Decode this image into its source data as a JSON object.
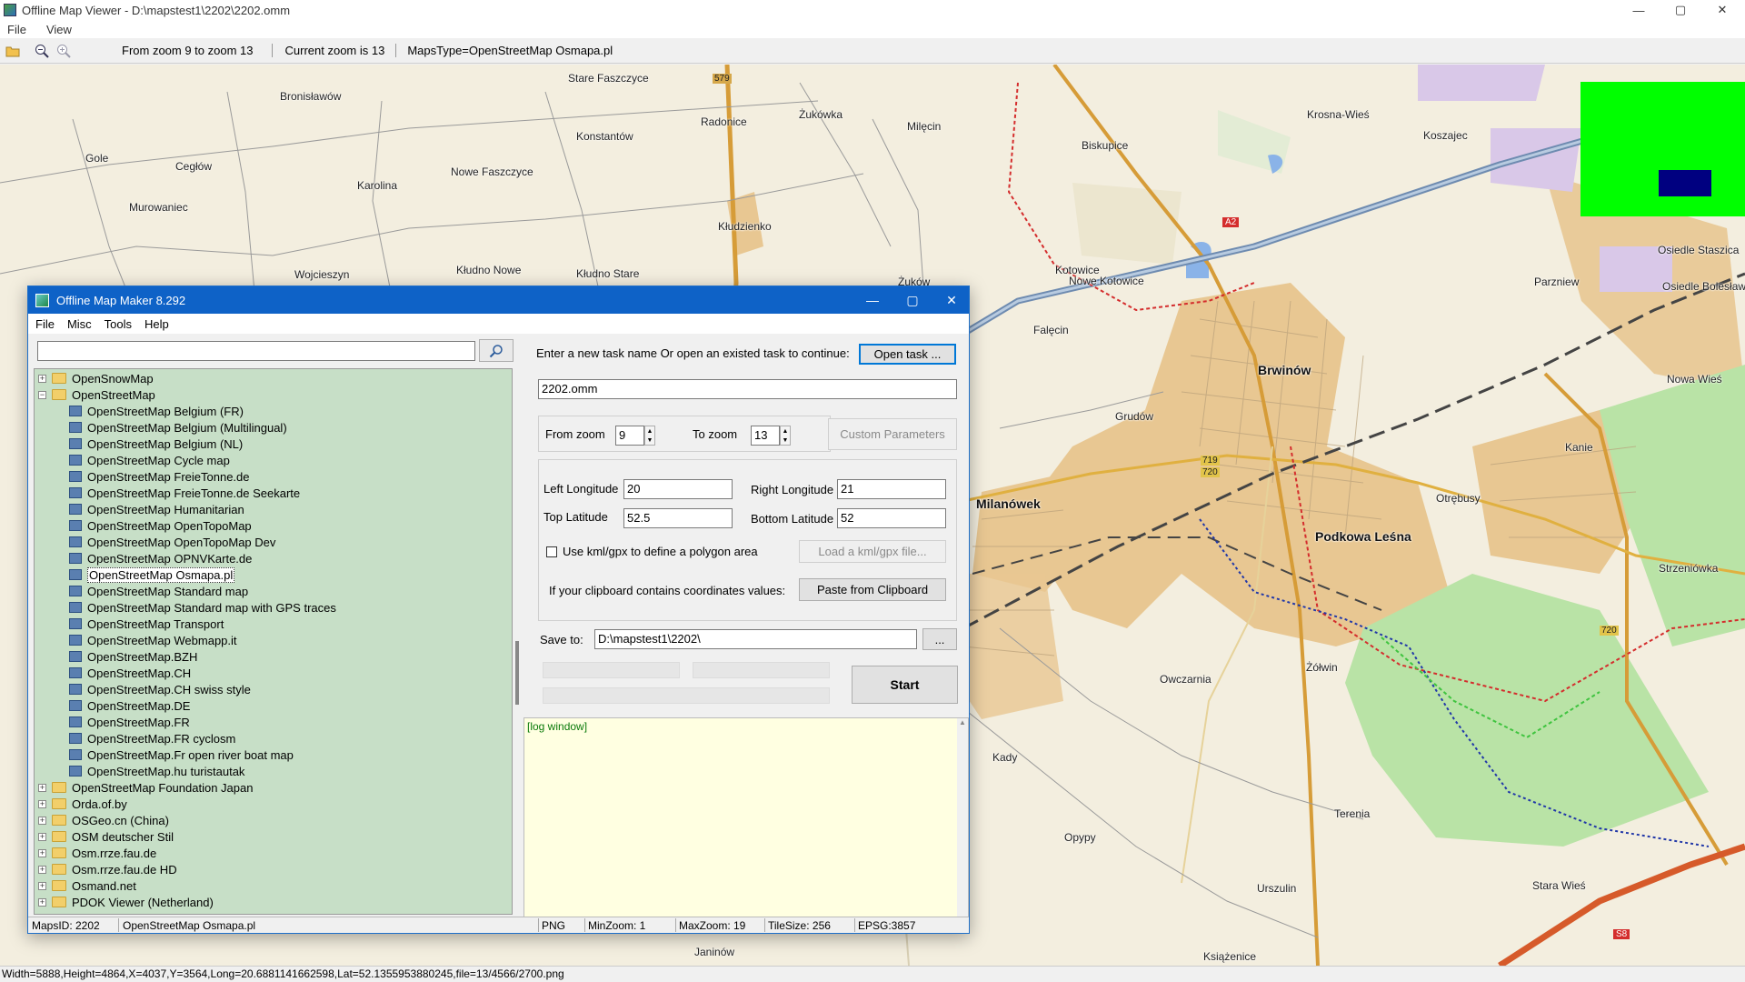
{
  "window": {
    "title": "Offline Map Viewer - D:\\mapstest1\\2202\\2202.omm",
    "menu": [
      "File",
      "View"
    ],
    "controls": {
      "minimize": "—",
      "maximize": "▢",
      "close": "✕"
    }
  },
  "toolbar": {
    "zoom_range": "From zoom 9 to zoom 13",
    "current_zoom": "Current zoom is 13",
    "maps_type": "MapsType=OpenStreetMap Osmapa.pl",
    "icons": [
      "open-folder-icon",
      "zoom-out-icon",
      "zoom-in-icon"
    ]
  },
  "map": {
    "places": [
      {
        "name": "Stare Faszczyce",
        "big": false
      },
      {
        "name": "Bronisławów",
        "big": false
      },
      {
        "name": "Radonice",
        "big": false
      },
      {
        "name": "Żukówka",
        "big": false
      },
      {
        "name": "Milęcin",
        "big": false
      },
      {
        "name": "Konstantów",
        "big": false
      },
      {
        "name": "Gole",
        "big": false
      },
      {
        "name": "Cegłów",
        "big": false
      },
      {
        "name": "Karolina",
        "big": false
      },
      {
        "name": "Nowe Faszczyce",
        "big": false
      },
      {
        "name": "Murowaniec",
        "big": false
      },
      {
        "name": "Kłudzienko",
        "big": false
      },
      {
        "name": "Wojcieszyn",
        "big": false
      },
      {
        "name": "Kłudno Nowe",
        "big": false
      },
      {
        "name": "Kłudno Stare",
        "big": false
      },
      {
        "name": "Żuków",
        "big": false
      },
      {
        "name": "Krosna-Wieś",
        "big": false
      },
      {
        "name": "Koszajec",
        "big": false
      },
      {
        "name": "Biskupice",
        "big": false
      },
      {
        "name": "Kotowice",
        "big": false
      },
      {
        "name": "Nowe Kotowice",
        "big": false
      },
      {
        "name": "Osiedle Staszica",
        "big": false
      },
      {
        "name": "Osiedle Bolesława",
        "big": false
      },
      {
        "name": "Parzniew",
        "big": false
      },
      {
        "name": "Falęcin",
        "big": false
      },
      {
        "name": "Brwinów",
        "big": true
      },
      {
        "name": "Nowa Wieś",
        "big": false
      },
      {
        "name": "Grudów",
        "big": false
      },
      {
        "name": "Milanówek",
        "big": true
      },
      {
        "name": "Otrębusy",
        "big": false
      },
      {
        "name": "Kanie",
        "big": false
      },
      {
        "name": "Podkowa Leśna",
        "big": true
      },
      {
        "name": "Strzeniówka",
        "big": false
      },
      {
        "name": "Owczarnia",
        "big": false
      },
      {
        "name": "Żółwin",
        "big": false
      },
      {
        "name": "Kady",
        "big": false
      },
      {
        "name": "Opypy",
        "big": false
      },
      {
        "name": "Terenia",
        "big": false
      },
      {
        "name": "Urszulin",
        "big": false
      },
      {
        "name": "Stara Wieś",
        "big": false
      },
      {
        "name": "Janinów",
        "big": false
      },
      {
        "name": "Książenice",
        "big": false
      }
    ],
    "road_numbers": [
      "579",
      "719",
      "720",
      "720",
      "A2",
      "S8"
    ]
  },
  "status": "Width=5888,Height=4864,X=4037,Y=3564,Long=20.6881141662598,Lat=52.1355953880245,file=13/4566/2700.png",
  "dialog": {
    "title": "Offline Map Maker 8.292",
    "menu": [
      "File",
      "Misc",
      "Tools",
      "Help"
    ],
    "search": {
      "value": "",
      "icon": "search-icon"
    },
    "tree": [
      {
        "label": "OpenSnowMap",
        "type": "folder",
        "expanded": false,
        "level": 0
      },
      {
        "label": "OpenStreetMap",
        "type": "folder",
        "expanded": true,
        "level": 0
      },
      {
        "label": "OpenStreetMap Belgium (FR)",
        "type": "map",
        "level": 1
      },
      {
        "label": "OpenStreetMap Belgium (Multilingual)",
        "type": "map",
        "level": 1
      },
      {
        "label": "OpenStreetMap Belgium (NL)",
        "type": "map",
        "level": 1
      },
      {
        "label": "OpenStreetMap Cycle map",
        "type": "map",
        "level": 1
      },
      {
        "label": "OpenStreetMap FreieTonne.de",
        "type": "map",
        "level": 1
      },
      {
        "label": "OpenStreetMap FreieTonne.de Seekarte",
        "type": "map",
        "level": 1
      },
      {
        "label": "OpenStreetMap Humanitarian",
        "type": "map",
        "level": 1
      },
      {
        "label": "OpenStreetMap OpenTopoMap",
        "type": "map",
        "level": 1
      },
      {
        "label": "OpenStreetMap OpenTopoMap Dev",
        "type": "map",
        "level": 1
      },
      {
        "label": "OpenStreetMap OPNVKarte.de",
        "type": "map",
        "level": 1
      },
      {
        "label": "OpenStreetMap Osmapa.pl",
        "type": "map",
        "level": 1,
        "selected": true
      },
      {
        "label": "OpenStreetMap Standard map",
        "type": "map",
        "level": 1
      },
      {
        "label": "OpenStreetMap Standard map with GPS traces",
        "type": "map",
        "level": 1
      },
      {
        "label": "OpenStreetMap Transport",
        "type": "map",
        "level": 1
      },
      {
        "label": "OpenStreetMap Webmapp.it",
        "type": "map",
        "level": 1
      },
      {
        "label": "OpenStreetMap.BZH",
        "type": "map",
        "level": 1
      },
      {
        "label": "OpenStreetMap.CH",
        "type": "map",
        "level": 1
      },
      {
        "label": "OpenStreetMap.CH swiss style",
        "type": "map",
        "level": 1
      },
      {
        "label": "OpenStreetMap.DE",
        "type": "map",
        "level": 1
      },
      {
        "label": "OpenStreetMap.FR",
        "type": "map",
        "level": 1
      },
      {
        "label": "OpenStreetMap.FR cyclosm",
        "type": "map",
        "level": 1
      },
      {
        "label": "OpenStreetMap.Fr open river boat map",
        "type": "map",
        "level": 1
      },
      {
        "label": "OpenStreetMap.hu turistautak",
        "type": "map",
        "level": 1
      },
      {
        "label": "OpenStreetMap Foundation Japan",
        "type": "folder",
        "expanded": false,
        "level": 0
      },
      {
        "label": "Orda.of.by",
        "type": "folder",
        "expanded": false,
        "level": 0
      },
      {
        "label": "OSGeo.cn (China)",
        "type": "folder",
        "expanded": false,
        "level": 0
      },
      {
        "label": "OSM deutscher Stil",
        "type": "folder",
        "expanded": false,
        "level": 0
      },
      {
        "label": "Osm.rrze.fau.de",
        "type": "folder",
        "expanded": false,
        "level": 0
      },
      {
        "label": "Osm.rrze.fau.de HD",
        "type": "folder",
        "expanded": false,
        "level": 0
      },
      {
        "label": "Osmand.net",
        "type": "folder",
        "expanded": false,
        "level": 0
      },
      {
        "label": "PDOK Viewer (Netherland)",
        "type": "folder",
        "expanded": false,
        "level": 0
      }
    ],
    "task_prompt": "Enter a new task name Or open an existed task to continue:",
    "open_task_label": "Open task ...",
    "task_name": "2202.omm",
    "from_zoom_label": "From zoom",
    "from_zoom": "9",
    "to_zoom_label": "To zoom",
    "to_zoom": "13",
    "custom_params_label": "Custom Parameters",
    "left_lon_label": "Left Longitude",
    "left_lon": "20",
    "right_lon_label": "Right Longitude",
    "right_lon": "21",
    "top_lat_label": "Top Latitude",
    "top_lat": "52.5",
    "bottom_lat_label": "Bottom Latitude",
    "bottom_lat": "52",
    "kml_label": "Use kml/gpx to define a polygon area",
    "kml_checked": false,
    "load_kml_label": "Load a kml/gpx file...",
    "clipboard_text": "If your clipboard contains coordinates values:",
    "paste_label": "Paste from Clipboard",
    "save_to_label": "Save to:",
    "save_to": "D:\\mapstest1\\2202\\",
    "browse_label": "...",
    "start_label": "Start",
    "log_text": "[log window]",
    "status": {
      "maps_id": "MapsID: 2202",
      "maps_name": "OpenStreetMap Osmapa.pl",
      "format": "PNG",
      "min_zoom": "MinZoom: 1",
      "max_zoom": "MaxZoom: 19",
      "tile_size": "TileSize: 256",
      "epsg": "EPSG:3857"
    }
  }
}
